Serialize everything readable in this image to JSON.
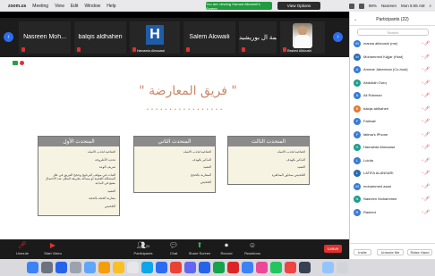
{
  "menubar": {
    "app": "zoom.us",
    "items": [
      "Meeting",
      "View",
      "Edit",
      "Window",
      "Help"
    ],
    "sharing_notice": "You are viewing Hamad Alkameli's Screen",
    "view_options": "View Options",
    "battery": "98%",
    "user": "Nasreen",
    "clock": "Mon 5:06 AM"
  },
  "gallery": {
    "tiles": [
      {
        "name": "Nasreen Moh...",
        "label": ""
      },
      {
        "name": "balqis aldhaheri",
        "label": ""
      },
      {
        "name": "",
        "label": "Hamaeda Almusawi",
        "logo_letter": "H"
      },
      {
        "name": "Salem Alowaili",
        "label": ""
      },
      {
        "name": "فاطمة ال بوريشيد",
        "label": ""
      },
      {
        "name": "",
        "label": "Rashed Albloushi"
      }
    ]
  },
  "slide": {
    "title": "\" فريق المعارضة \"",
    "boxes": [
      {
        "heading": "المتحدث الأول",
        "items": [
          "افتتاحية لجذب الانتباه",
          "تحديد الأطروحة",
          "تعريف الوعد",
          "الثبات في موقف البرنامج وحجج الفريق في ظل المشكلة القضية أو مسألة بطريقة البطل عند الاحتمال مقنع في البداية",
          "التفنيد",
          "مقارنة الحجة بالحجة",
          "التلخيص"
        ]
      },
      {
        "heading": "المتحدث الثاني",
        "items": [
          "افتتاحية لجذب الانتباه",
          "التذكير بالهدف",
          "التفنيد",
          "المقارنة بالحجج",
          "التلخيص"
        ]
      },
      {
        "heading": "المتحدث الثالث",
        "items": [
          "افتتاحية لجذب الانتباه",
          "التذكير بالهدف",
          "التفنيد",
          "التلخيص بمحاور المناظرة"
        ]
      }
    ]
  },
  "controls": {
    "buttons": [
      {
        "label": "Unmute",
        "icon": "microphone-muted-icon"
      },
      {
        "label": "Start Video",
        "icon": "video-off-icon"
      },
      {
        "label": "Participants",
        "icon": "participants-icon",
        "count": "22"
      },
      {
        "label": "Chat",
        "icon": "chat-icon"
      },
      {
        "label": "Share Screen",
        "icon": "share-screen-icon"
      },
      {
        "label": "Record",
        "icon": "record-icon"
      },
      {
        "label": "Reactions",
        "icon": "reactions-icon"
      }
    ],
    "leave": "Leave"
  },
  "participants_panel": {
    "title": "Participants (22)",
    "search_placeholder": "Search",
    "people": [
      {
        "name": "marwa alblooshi (me)",
        "initial": "M",
        "color": "#3a7bd5"
      },
      {
        "name": "Mohammed Kajjar (Host)",
        "initial": "M",
        "color": "#2b6ab0"
      },
      {
        "name": "Ammar Jaberman (Co-host)",
        "initial": "A",
        "color": "#3a7bd5"
      },
      {
        "name": "Abdullah Ouroj",
        "initial": "A",
        "color": "#1f9d8b"
      },
      {
        "name": "Ali Rahman",
        "initial": "A",
        "color": "#3a7bd5"
      },
      {
        "name": "balqis aldhaheri",
        "initial": "B",
        "color": "#e07b39"
      },
      {
        "name": "Fatimah",
        "initial": "F",
        "color": "#3a7bd5"
      },
      {
        "name": "fatima's iPhone",
        "initial": "F",
        "color": "#3a7bd5"
      },
      {
        "name": "Hamaeda Almusawi",
        "initial": "H",
        "color": "#1f9d8b"
      },
      {
        "name": "Lolofa",
        "initial": "L",
        "color": "#3a7bd5"
      },
      {
        "name": "LATIFA ALANSARI",
        "initial": "L",
        "color": "#2b6ab0"
      },
      {
        "name": "mohammed asad",
        "initial": "M",
        "color": "#3a7bd5"
      },
      {
        "name": "Nasreen Mohammed",
        "initial": "N",
        "color": "#1f9d8b"
      },
      {
        "name": "Rashed",
        "initial": "R",
        "color": "#3a7bd5"
      }
    ],
    "footer": [
      "Invite",
      "Unmute Me",
      "Raise Hand"
    ]
  }
}
